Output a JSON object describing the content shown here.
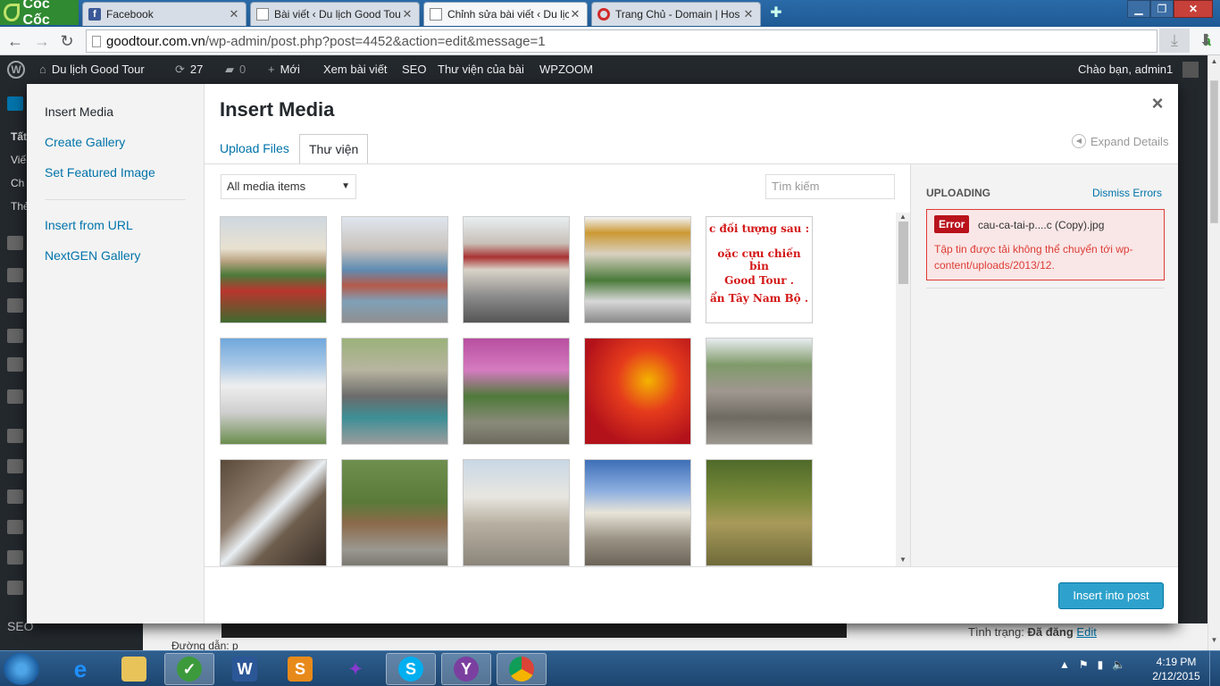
{
  "browser": {
    "brand": "Cốc Cốc",
    "tabs": [
      {
        "title": "Facebook",
        "icon": "facebook-icon"
      },
      {
        "title": "Bài viết ‹ Du lịch Good Tou",
        "icon": "page-icon"
      },
      {
        "title": "Chỉnh sửa bài viết ‹ Du lịch",
        "icon": "page-icon"
      },
      {
        "title": "Trang Chủ - Domain | Hos",
        "icon": "opera-icon"
      }
    ],
    "url_host": "goodtour.com.vn",
    "url_path": "/wp-admin/post.php?post=4452&action=edit&message=1"
  },
  "adminbar": {
    "site": "Du lịch Good Tour",
    "updates": "27",
    "comments": "0",
    "new": "Mới",
    "view": "Xem bài viết",
    "seo": "SEO",
    "library": "Thư viện của bài",
    "wpzoom": "WPZOOM",
    "greeting": "Chào bạn, admin1"
  },
  "background": {
    "sidebar_items": [
      "Tất",
      "Viế",
      "Ch",
      "Thẻ"
    ],
    "seo": "SEO",
    "path_label": "Đường dẫn: p",
    "status_label": "Tình trạng:",
    "status_value": "Đã đăng",
    "status_edit": "Edit"
  },
  "modal": {
    "menu": [
      "Insert Media",
      "Create Gallery",
      "Set Featured Image",
      "Insert from URL",
      "NextGEN Gallery"
    ],
    "title": "Insert Media",
    "tab_upload": "Upload Files",
    "tab_library": "Thư viện",
    "expand": "Expand Details",
    "filter": "All media items",
    "search_placeholder": "Tìm kiếm",
    "uploading": "UPLOADING",
    "dismiss": "Dismiss Errors",
    "error_badge": "Error",
    "error_file": "cau-ca-tai-p....c (Copy).jpg",
    "error_msg": "Tập tin được tải không thể chuyển tới wp-content/uploads/2013/12.",
    "insert_button": "Insert into post",
    "thumbnail_caption_lines": [
      "c đối tượng sau :",
      "oặc cựu chiến bin",
      "Good Tour .",
      "ẩn Tây Nam Bộ ."
    ],
    "thumbnails": [
      {
        "name": "pagoda-garden"
      },
      {
        "name": "market-umbrellas"
      },
      {
        "name": "cho-da-lat-vendor"
      },
      {
        "name": "cho-da-lat-square"
      },
      {
        "name": "red-text-banner"
      },
      {
        "name": "white-house"
      },
      {
        "name": "courtyard-tiles"
      },
      {
        "name": "bougainvillea-path"
      },
      {
        "name": "red-fireworks-poster"
      },
      {
        "name": "temple-stairs"
      },
      {
        "name": "waterfall-rocks"
      },
      {
        "name": "forest-road"
      },
      {
        "name": "elephant-pillar"
      },
      {
        "name": "white-stupa"
      },
      {
        "name": "forest-stream"
      }
    ]
  },
  "taskbar": {
    "time": "4:19 PM",
    "date": "2/12/2015",
    "apps": [
      "ie-icon",
      "explorer-icon",
      "coccoc-icon",
      "word-icon",
      "slides-icon",
      "purple-app-icon",
      "skype-icon",
      "yahoo-icon",
      "chrome-icon"
    ]
  }
}
